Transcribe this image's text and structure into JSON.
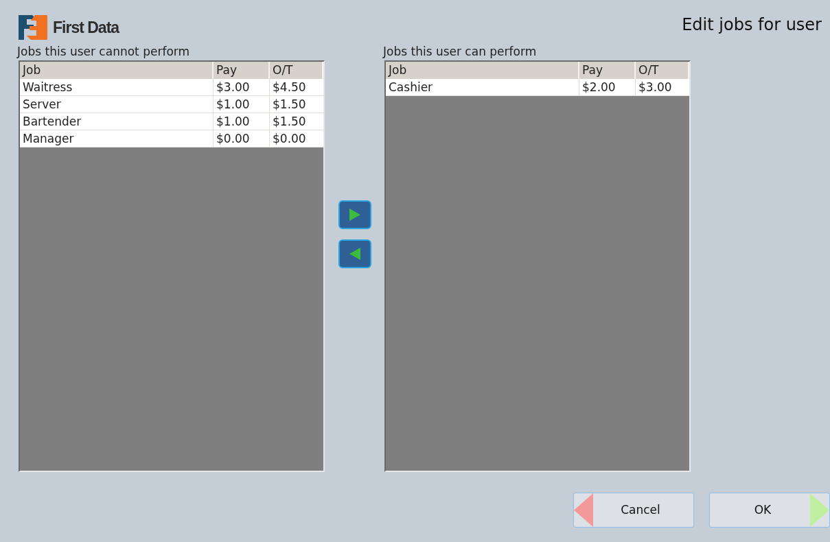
{
  "logo": {
    "text": "First Data"
  },
  "title": "Edit jobs for user",
  "lists": [
    {
      "heading": "Jobs this user cannot perform",
      "columns": [
        "Job",
        "Pay",
        "O/T"
      ],
      "rows": [
        {
          "cells": [
            "Waitress",
            "$3.00",
            "$4.50"
          ]
        },
        {
          "cells": [
            "Server",
            "$1.00",
            "$1.50"
          ]
        },
        {
          "cells": [
            "Bartender",
            "$1.00",
            "$1.50"
          ]
        },
        {
          "cells": [
            "Manager",
            "$0.00",
            "$0.00"
          ]
        }
      ]
    },
    {
      "heading": "Jobs this user can perform",
      "columns": [
        "Job",
        "Pay",
        "O/T"
      ],
      "rows": [
        {
          "cells": [
            "Cashier",
            "$2.00",
            "$3.00"
          ]
        }
      ]
    }
  ],
  "move_buttons": [
    {
      "kind": "add"
    },
    {
      "kind": "remove"
    }
  ],
  "buttons": [
    {
      "kind": "cancel",
      "label": "Cancel"
    },
    {
      "kind": "ok",
      "label": "OK"
    }
  ]
}
